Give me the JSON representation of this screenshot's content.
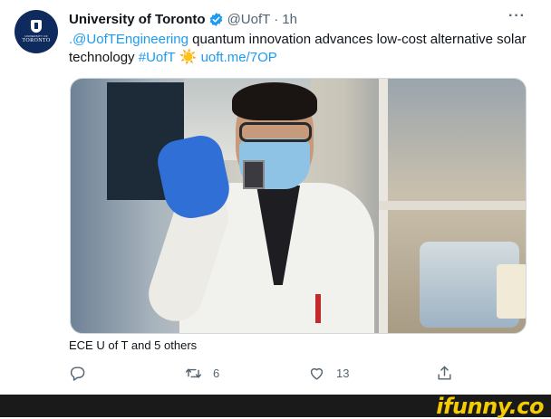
{
  "tweet": {
    "display_name": "University of Toronto",
    "handle": "@UofT",
    "separator": "·",
    "time": "1h",
    "more_glyph": "···",
    "avatar": {
      "line1": "UNIVERSITY OF",
      "line2": "TORONTO"
    },
    "text": {
      "mention": ".@UofTEngineering",
      "body": " quantum innovation advances low-cost alternative solar technology ",
      "hashtag": "#UofT",
      "emoji": "☀️",
      "url": "uoft.me/7OP"
    },
    "liked_by": "ECE U of T and 5 others",
    "actions": {
      "reply": {
        "icon": "reply-icon",
        "count": ""
      },
      "retweet": {
        "icon": "retweet-icon",
        "count": "6"
      },
      "like": {
        "icon": "heart-icon",
        "count": "13"
      },
      "share": {
        "icon": "share-icon",
        "count": ""
      }
    }
  },
  "watermark": {
    "text": "ifunny.co",
    "color": "#f5cc00"
  },
  "colors": {
    "link": "#1d9bf0",
    "verified": "#1d9bf0",
    "secondary_text": "#536471",
    "primary_text": "#0f1419"
  }
}
